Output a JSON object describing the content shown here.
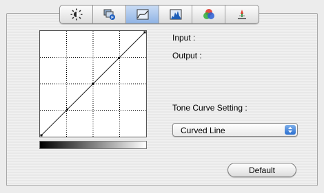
{
  "tabs": [
    {
      "name": "brightness-icon",
      "active": false
    },
    {
      "name": "preview-icon",
      "active": false
    },
    {
      "name": "tone-curve-icon",
      "active": true
    },
    {
      "name": "histogram-icon",
      "active": false
    },
    {
      "name": "color-balance-icon",
      "active": false
    },
    {
      "name": "color-picker-icon",
      "active": false
    }
  ],
  "graph": {
    "grid_divisions": 4,
    "curve_points": [
      [
        0,
        0
      ],
      [
        0.25,
        0.25
      ],
      [
        0.5,
        0.5
      ],
      [
        0.75,
        0.75
      ],
      [
        1,
        1
      ]
    ]
  },
  "info": {
    "input_label": "Input :",
    "output_label": "Output :"
  },
  "tone_curve": {
    "label": "Tone Curve Setting :",
    "selected": "Curved Line"
  },
  "buttons": {
    "default_label": "Default"
  }
}
